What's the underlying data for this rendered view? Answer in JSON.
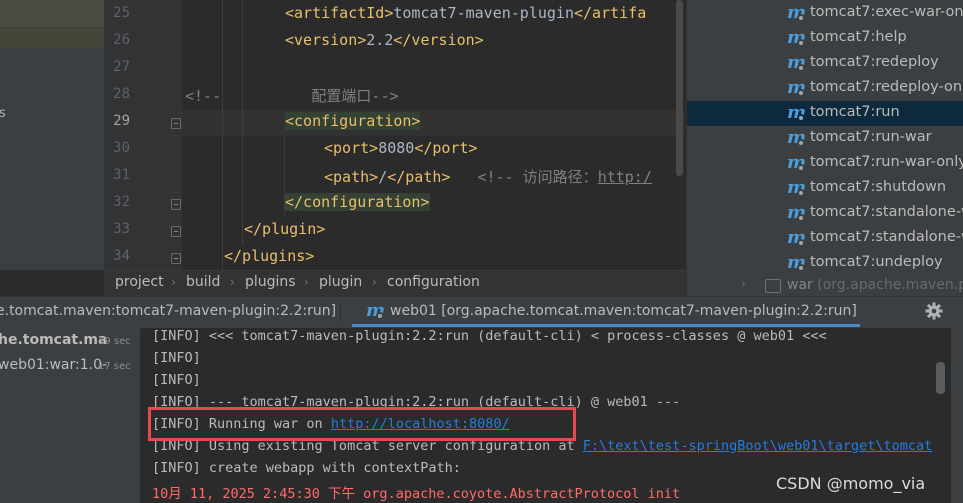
{
  "left_panel": {
    "fragment": "s"
  },
  "editor": {
    "line_numbers": [
      "25",
      "26",
      "27",
      "28",
      "29",
      "30",
      "31",
      "32",
      "33",
      "34"
    ],
    "artifact_open": "<artifactId>",
    "artifact_value": "tomcat7-maven-plugin",
    "artifact_close": "</artifa",
    "version_open": "<version>",
    "version_value": "2.2",
    "version_close": "</version>",
    "comment_port": "<!--          配置端口-->",
    "config_open": "<configuration>",
    "port_open": "<port>",
    "port_value": "8080",
    "port_close": "</port>",
    "path_open": "<path>",
    "path_value": "/",
    "path_close": "</path>",
    "path_comment_prefix": "<!-- 访问路径：",
    "path_comment_link": "http:/",
    "config_close": "</configuration>",
    "plugin_close": "</plugin>",
    "plugins_close": "</plugins>"
  },
  "breadcrumb": [
    "project",
    "build",
    "plugins",
    "plugin",
    "configuration"
  ],
  "maven": {
    "items": [
      "tomcat7:exec-war-only",
      "tomcat7:help",
      "tomcat7:redeploy",
      "tomcat7:redeploy-only",
      "tomcat7:run",
      "tomcat7:run-war",
      "tomcat7:run-war-only",
      "tomcat7:shutdown",
      "tomcat7:standalone-w",
      "tomcat7:standalone-w",
      "tomcat7:undeploy"
    ],
    "selected": "tomcat7:run",
    "war_label": "war",
    "war_suffix": "(org.apache.maven.pl"
  },
  "run_tabs": {
    "tab1": "e.tomcat.maven:tomcat7-maven-plugin:2.2:run]",
    "tab2": "web01 [org.apache.tomcat.maven:tomcat7-maven-plugin:2.2:run]"
  },
  "run_tree": [
    {
      "label": "he.tomcat.ma",
      "time": "19 sec"
    },
    {
      "label": "web01:war:1.0-",
      "time": "17 sec"
    }
  ],
  "console": {
    "lines": [
      "[INFO] <<< tomcat7-maven-plugin:2.2:run (default-cli) < process-classes @ web01 <<<",
      "[INFO]",
      "[INFO]",
      "[INFO] --- tomcat7-maven-plugin:2.2:run (default-cli) @ web01 ---"
    ],
    "running_prefix": "[INFO] Running war on ",
    "running_url": "http://localhost:8080/",
    "using_prefix": "[INFO] Using existing Tomcat server configuration at ",
    "using_path": "F:\\text\\test-springBoot\\web01\\target\\tomcat",
    "webapp_line": "[INFO] create webapp with contextPath:",
    "err_line": "10月 11, 2025 2:45:30 下午 org.apache.coyote.AbstractProtocol init"
  },
  "watermark": "CSDN @momo_via",
  "colors": {
    "accent": "#4a88c7",
    "highlight_box": "#e6494f",
    "maven_icon": "#4a9ede"
  }
}
